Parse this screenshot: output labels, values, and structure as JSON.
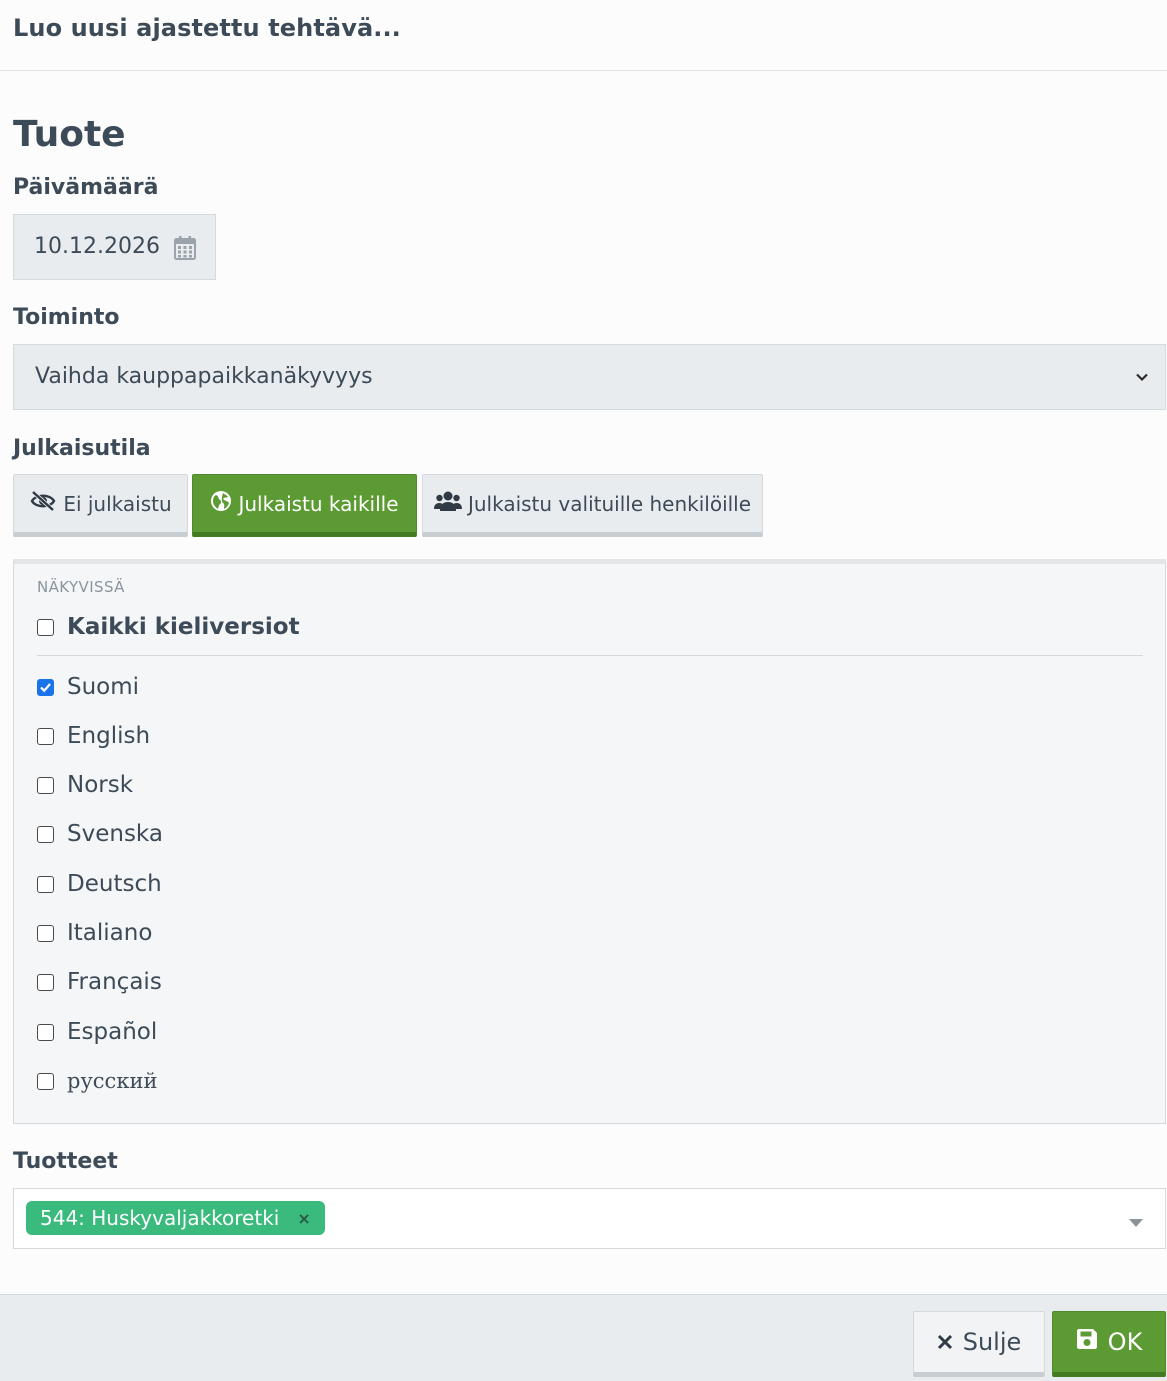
{
  "modal": {
    "title": "Luo uusi ajastettu tehtävä..."
  },
  "section_title": "Tuote",
  "date": {
    "label": "Päivämäärä",
    "value": "10.12.2026",
    "icon": "calendar-icon"
  },
  "action": {
    "label": "Toiminto",
    "selected": "Vaihda kauppapaikkanäkyvyys"
  },
  "publish_state": {
    "label": "Julkaisutila",
    "options": [
      {
        "label": "Ei julkaistu",
        "icon": "eye-slash-icon",
        "active": false
      },
      {
        "label": "Julkaistu kaikille",
        "icon": "globe-icon",
        "active": true
      },
      {
        "label": "Julkaistu valituille henkilöille",
        "icon": "users-icon",
        "active": false
      }
    ],
    "active_color": "#5c9b34"
  },
  "visibility": {
    "heading": "NÄKYVISSÄ",
    "all_label": "Kaikki kieliversiot",
    "all_checked": false,
    "languages": [
      {
        "label": "Suomi",
        "checked": true
      },
      {
        "label": "English",
        "checked": false
      },
      {
        "label": "Norsk",
        "checked": false
      },
      {
        "label": "Svenska",
        "checked": false
      },
      {
        "label": "Deutsch",
        "checked": false
      },
      {
        "label": "Italiano",
        "checked": false
      },
      {
        "label": "Français",
        "checked": false
      },
      {
        "label": "Español",
        "checked": false
      },
      {
        "label": "русский",
        "checked": false
      }
    ]
  },
  "products": {
    "label": "Tuotteet",
    "tags": [
      {
        "label": "544: Huskyvaljakkoretki",
        "remove": "×"
      }
    ],
    "tag_color": "#3aba7c"
  },
  "footer": {
    "close_label": "Sulje",
    "ok_label": "OK"
  }
}
